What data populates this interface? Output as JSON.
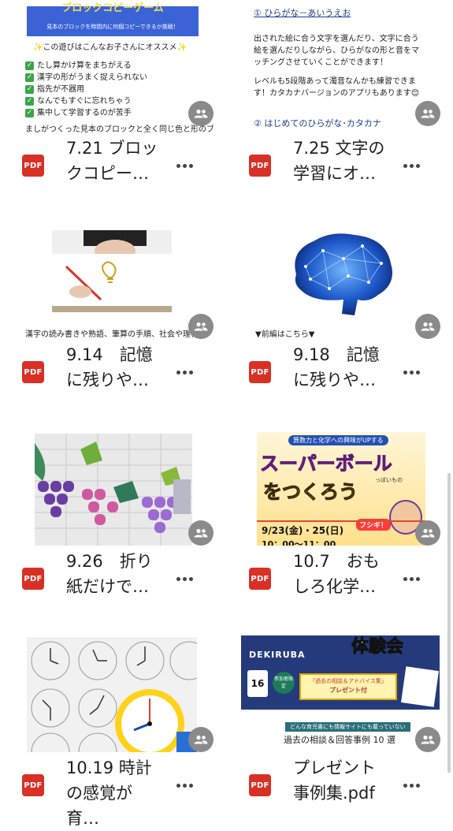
{
  "files": [
    {
      "title": "7.21 ブロックコピー…",
      "type": "PDF",
      "thumb": {
        "heading": "ブロックコピーゲーム",
        "sub": "見本のブロックを時間内に何個コピーできるか挑戦！",
        "intro": "✨この遊びはこんなお子さんにオススメ✨",
        "checks": [
          "たし算かけ算をまちがえる",
          "漢字の形がうまく捉えられない",
          "指先が不器用",
          "なんでもすぐに忘れちゃう",
          "集中して学習するのが苦手"
        ],
        "footer": "ましがつくった見本のブロックと全く同じ色と形のブ"
      }
    },
    {
      "title": "7.25 文字の学習にオ…",
      "type": "PDF",
      "thumb": {
        "item1": "① ひらがな－あいうえお",
        "p1": "出された絵に合う文字を選んだり、文字に合う絵を選んだりしながら、ひらがなの形と音をマッチングさせていくことができます！",
        "p2": "レベルも5段階あって濁音なんかも練習できます！カタカナバージョンのアプリもあります😊",
        "item2": "② はじめてのひらがな･カタカナ"
      }
    },
    {
      "title": "9.14　記憶に残りや…",
      "type": "PDF",
      "thumb": {
        "caption": "漢字の読み書きや熟語、筆算の手順、社会や理科"
      }
    },
    {
      "title": "9.18　記憶に残りや…",
      "type": "PDF",
      "thumb": {
        "caption": "▼前編はこちら▼"
      }
    },
    {
      "title": "9.26　折り紙だけで…",
      "type": "PDF",
      "thumb": {}
    },
    {
      "title": "10.7　おもしろ化学…",
      "type": "PDF",
      "thumb": {
        "top": "算数力と化学への興味がUPする",
        "big1": "スーパーボール",
        "big2": "をつくろう",
        "side": "っぽいもの",
        "date": "9/23(金)・25(日)",
        "time": "10：00～11：00",
        "fushigi": "フシギ！"
      }
    },
    {
      "title": "10.19 時計の感覚が育…",
      "type": "PDF",
      "thumb": {}
    },
    {
      "title": "プレゼント事例集.pdf",
      "type": "PDF",
      "thumb": {
        "banner": "体験会",
        "brand": "DEKIRUBA",
        "badge": "参加者限定",
        "num": "16",
        "gift1": "「過去の相談＆アドバイス集」",
        "gift2": "プレゼント付",
        "strip": "どんな育児書にも情報サイトにも載っていない",
        "caption": "過去の相談＆回答事例 10 選"
      }
    }
  ],
  "colors": {
    "pdf": "#d93025",
    "share_bg": "#8a8a8a",
    "link": "#1a3c8c"
  },
  "icons": {
    "share": "people-icon",
    "more": "more-vert-icon",
    "pdf": "pdf-icon"
  }
}
